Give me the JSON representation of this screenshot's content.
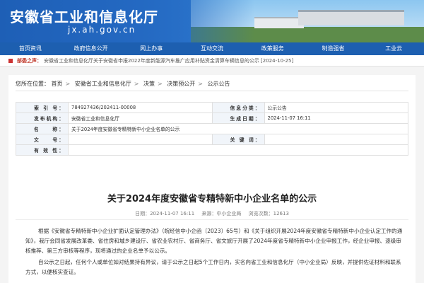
{
  "header": {
    "title": "安徽省工业和信息化厅",
    "url": "jx.ah.gov.cn"
  },
  "nav": [
    "首页资讯",
    "政府信息公开",
    "网上办事",
    "互动交流",
    "政策服务",
    "制造强省",
    "工业云"
  ],
  "notice": {
    "label": "部委之声：",
    "text": "安徽省工业和信息化厅关于安徽省申报2022年度新能源汽车推广应用补贴资金清算车辆信息的公示 [2024-10-25]"
  },
  "breadcrumb": {
    "prefix": "您所在位置：",
    "items": [
      "首页",
      "安徽省工业和信息化厅",
      "决策",
      "决策预公开",
      "公示公告"
    ]
  },
  "meta": {
    "index_label": "索 引 号：",
    "index_value": "784927436/202411-00008",
    "category_label": "信息分类：",
    "category_value": "公示公告",
    "publisher_label": "发布机构：",
    "publisher_value": "安徽省工业和信息化厅",
    "date_label": "生成日期：",
    "date_value": "2024-11-07 16:11",
    "name_label": "名　　称：",
    "name_value": "关于2024年度安徽省专精特新中小企业名单的公示",
    "docno_label": "文　　号：",
    "docno_value": "",
    "keyword_label": "关 键 词：",
    "keyword_value": "",
    "validity_label": "有 效 性：",
    "validity_value": ""
  },
  "article": {
    "title": "关于2024年度安徽省专精特新中小企业名单的公示",
    "date": "日期：2024-11-07 16:11",
    "source": "来源：中小企业局",
    "views": "浏览次数：12613",
    "paragraphs": [
      "根据《安徽省专精特新中小企业扩面认定管理办法》（皖经信中小企函〔2023〕65号）和《关于组织开展2024年度安徽省专精特新中小企业认定工作的通知》，我厅会同省发展改革委、省住房和城乡建设厅、省农业农村厅、省商务厅、省文旅厅开展了2024年度省专精特新中小企业申报工作，经企业申报、逐级审核推荐、第三方审核等程序，现将通过的企业名单予以公示。",
      "自公示之日起，任何个人或单位如对结果持有异议，请于公示之日起5个工作日内，实名向省工业和信息化厅（中小企业局）反映，并提供佐证材料和联系方式，以便核实查证。"
    ]
  }
}
